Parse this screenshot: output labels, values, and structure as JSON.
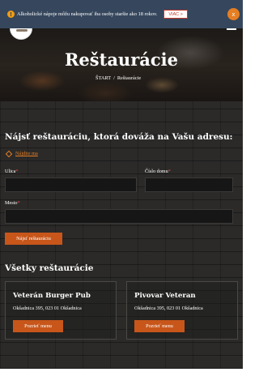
{
  "alert": {
    "message": "Alkoholické nápoje môžu nakupovať iba osoby staršie ako 18 rokov.",
    "more_label": "VIAC >",
    "close_label": "x"
  },
  "header": {
    "menu_glyph": "≡"
  },
  "hero": {
    "title": "Reštaurácie",
    "breadcrumb": [
      "ŠTART",
      "/",
      "Reštaurácie"
    ]
  },
  "search": {
    "heading": "Nájsť reštauráciu, ktorá dováža na Vašu adresu:",
    "locate_link": "Nájdite ma",
    "street_label": "Ulica",
    "number_label": "Číslo domu",
    "city_label": "Mesto",
    "required_mark": "*",
    "street_value": "",
    "number_value": "",
    "city_value": "",
    "submit_label": "Nájsť reštauráciu"
  },
  "restaurants": {
    "heading": "Všetky reštaurácie",
    "items": [
      {
        "name": "Veterán Burger Pub",
        "address": "Okšadnica 395, 023 01 Okšadnica",
        "button": "Pozrieť menu"
      },
      {
        "name": "Pivovar Veteran",
        "address": "Okšadnica 395, 023 01 Okšadnica",
        "button": "Pozrieť menu"
      }
    ]
  },
  "colors": {
    "alert_bg": "#36475d",
    "accent": "#c8561a",
    "link": "#e67e22",
    "page_bg": "#2b2a29"
  }
}
